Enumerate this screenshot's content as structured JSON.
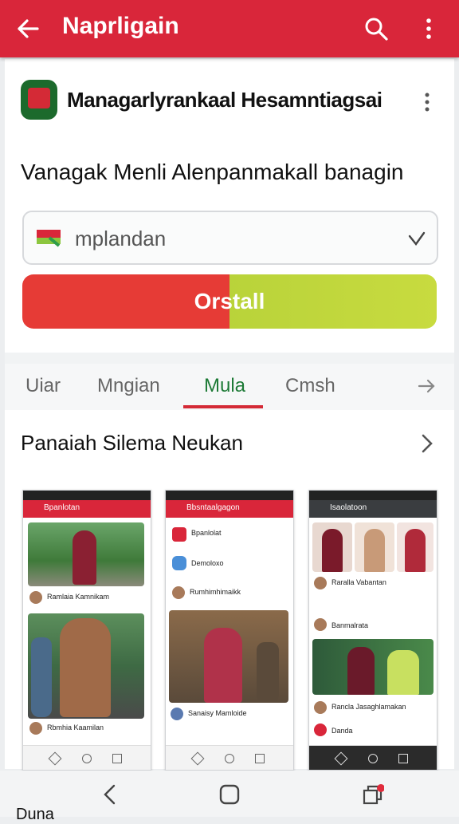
{
  "appbar": {
    "title": "Naprligain",
    "back_icon": "arrow-left-icon",
    "search_icon": "search-icon",
    "more_icon": "more-vert-icon"
  },
  "app": {
    "name": "Managarlyrankaal Hesamntiagsai",
    "subtitle": "Vanagak Menli Alenpanmakall banagin"
  },
  "field": {
    "value": "mplandan"
  },
  "install": {
    "label": "Orstall"
  },
  "tabs": [
    {
      "label": "Uiar"
    },
    {
      "label": "Mngian"
    },
    {
      "label": "Mula"
    },
    {
      "label": "Cmsh"
    }
  ],
  "section": {
    "title": "Panaiah Silema Neukan"
  },
  "screenshots": [
    {
      "bar_title": "Bpanlotan",
      "posts": [
        {
          "author": "Ramlaia Kamnikam"
        },
        {
          "author": "Rbmhia Kaamilan"
        }
      ]
    },
    {
      "bar_title": "Bbsntaalgagon",
      "list": [
        {
          "label": "Bpanlolat"
        },
        {
          "label": "Demoloxo"
        }
      ],
      "posts": [
        {
          "author": "Rumhimhimaikk"
        },
        {
          "author": "Sanaisy Mamloide"
        }
      ]
    },
    {
      "bar_title": "Isaolatoon",
      "posts": [
        {
          "author": "Raralla Vabantan"
        },
        {
          "author": "Banmalrata"
        },
        {
          "author": "Rancla Jasaghlamakan"
        },
        {
          "author": "Danda"
        }
      ]
    }
  ],
  "peek": {
    "text": "Duna"
  },
  "colors": {
    "brand_red": "#d9263a",
    "install_left": "#e63b36",
    "install_right": "#c8db3f",
    "active_tab": "#1d7a36"
  }
}
